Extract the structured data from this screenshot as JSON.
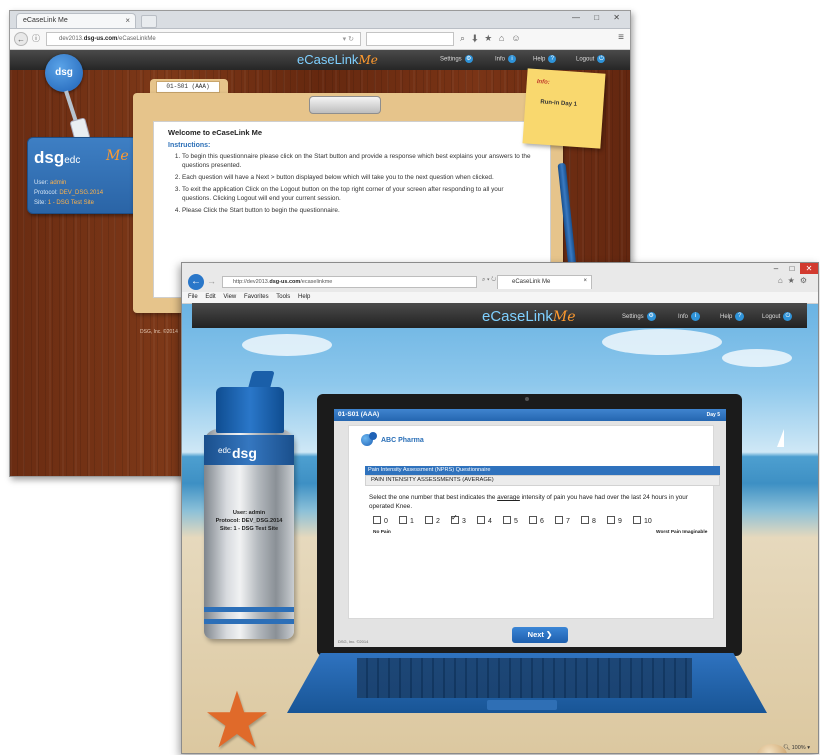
{
  "windowA": {
    "tab_title": "eCaseLink Me",
    "tab_close": "×",
    "url_prefix": "dev2013.",
    "url_domain": "dsg-us.com",
    "url_path": "/eCaseLinkMe",
    "app_brand": "eCaseLink",
    "app_brand_suffix": "Me",
    "nav": {
      "settings": "Settings",
      "info": "Info",
      "help": "Help",
      "logout": "Logout"
    },
    "badge_label": "dsg",
    "idcard": {
      "logo": "dsg",
      "logo_suffix": "edc",
      "me": "Me",
      "user_label": "User:",
      "user_value": "admin",
      "protocol_label": "Protocol:",
      "protocol_value": "DEV_DSG.2014",
      "site_label": "Site:",
      "site_value": "1 - DSG Test Site"
    },
    "folder_tab": "01-S01 (AAA)",
    "welcome_title": "Welcome to eCaseLink Me",
    "instructions_heading": "Instructions:",
    "instructions": [
      "To begin this questionnaire please click on the Start button and provide a response which best explains your answers to the questions presented.",
      "Each question will have a Next > button displayed below which will take you to the next question when clicked.",
      "To exit the application Click on the Logout button on the top right corner of your screen after responding to all your questions. Clicking Logout will end your current session.",
      "Please Click the Start button to begin the questionnaire."
    ],
    "sticky_title": "Info:",
    "sticky_body": "Run-in Day 1",
    "footer": "DSG, Inc. ©2014"
  },
  "windowB": {
    "url_prefix": "http://dev2013.",
    "url_domain": "dsg-us.com",
    "url_path": "/ecaselinkme",
    "tab_title": "eCaseLink Me",
    "menu": [
      "File",
      "Edit",
      "View",
      "Favorites",
      "Tools",
      "Help"
    ],
    "app_brand": "eCaseLink",
    "app_brand_suffix": "Me",
    "nav": {
      "settings": "Settings",
      "info": "Info",
      "help": "Help",
      "logout": "Logout"
    },
    "bottle": {
      "logo": "dsg",
      "logo_suffix": "edc",
      "user": "User: admin",
      "protocol": "Protocol: DEV_DSG.2014",
      "site": "Site: 1 - DSG Test Site"
    },
    "screen": {
      "header_left": "01-S01 (AAA)",
      "header_right": "Day 5",
      "sponsor": "ABC Pharma",
      "questionnaire": "Pain Intensity Assessment (NPRS) Questionnaire",
      "section": "PAIN INTENSITY ASSESSMENTS (AVERAGE)",
      "question_pre": "Select the one number that best indicates the ",
      "question_em": "average",
      "question_post": " intensity of pain you have had over the last 24 hours in your operated Knee.",
      "options": [
        "0",
        "1",
        "2",
        "3",
        "4",
        "5",
        "6",
        "7",
        "8",
        "9",
        "10"
      ],
      "selected_option": "3",
      "anchor_low": "No Pain",
      "anchor_high": "Worst Pain Imaginable",
      "next_label": "Next",
      "footer": "DSG, Inc. ©2014"
    },
    "zoom": "100%"
  }
}
